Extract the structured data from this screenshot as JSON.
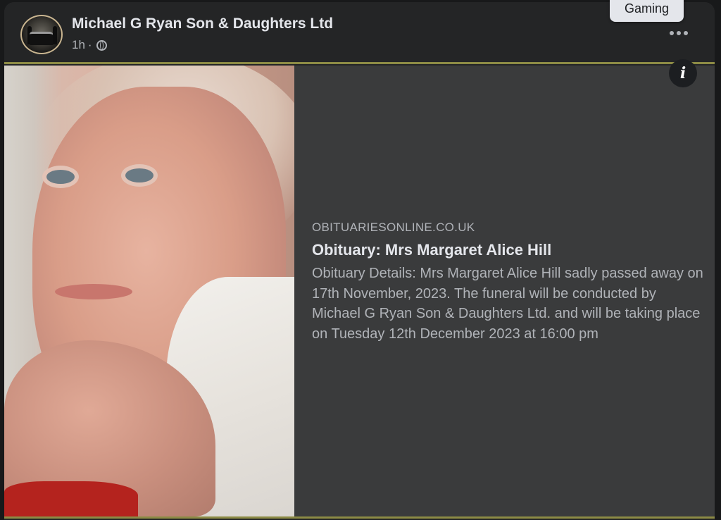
{
  "post": {
    "page_name": "Michael G Ryan Son & Daughters Ltd",
    "time": "1h",
    "separator": "·",
    "audience_icon": "globe-icon",
    "more_icon": "more-horizontal-icon"
  },
  "tooltip": {
    "label": "Gaming"
  },
  "link_preview": {
    "domain": "OBITUARIESONLINE.CO.UK",
    "title": "Obituary: Mrs Margaret Alice Hill",
    "description": "Obituary Details: Mrs Margaret Alice Hill sadly passed away on 17th November, 2023. The funeral will be conducted by Michael G Ryan Son & Daughters Ltd. and will be taking place on Tuesday 12th December 2023 at 16:00 pm",
    "info_icon": "info-icon",
    "info_glyph": "i"
  },
  "colors": {
    "background": "#18191a",
    "card": "#242526",
    "preview_panel": "#3a3b3c",
    "rule": "#8c8b45",
    "primary_text": "#e4e6eb",
    "secondary_text": "#b0b3b8"
  }
}
